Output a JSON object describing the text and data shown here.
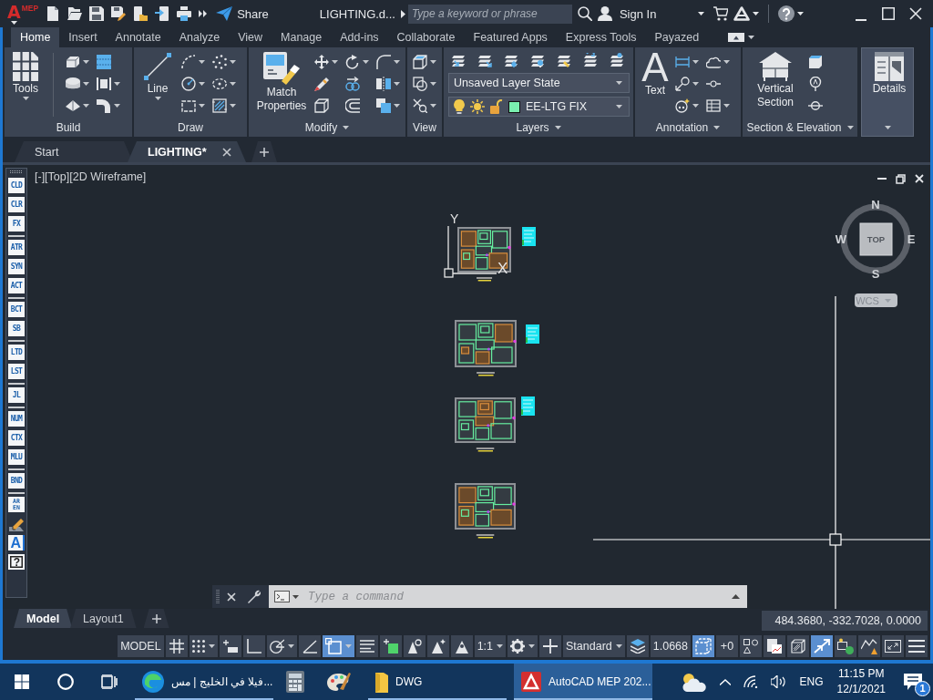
{
  "title_bar": {
    "app_letter": "A",
    "app_badge": "MEP",
    "share": "Share",
    "document": "LIGHTING.d...",
    "search": {
      "placeholder": "Type a keyword or phrase"
    },
    "sign_in": "Sign In"
  },
  "ribbon": {
    "tabs": [
      {
        "label": "Home",
        "selected": true
      },
      {
        "label": "Insert",
        "selected": false
      },
      {
        "label": "Annotate",
        "selected": false
      },
      {
        "label": "Analyze",
        "selected": false
      },
      {
        "label": "View",
        "selected": false
      },
      {
        "label": "Manage",
        "selected": false
      },
      {
        "label": "Add-ins",
        "selected": false
      },
      {
        "label": "Collaborate",
        "selected": false
      },
      {
        "label": "Featured Apps",
        "selected": false
      },
      {
        "label": "Express Tools",
        "selected": false
      },
      {
        "label": "Payazed",
        "selected": false
      }
    ],
    "panels": [
      {
        "kind": "build",
        "title": "Build",
        "menu": false,
        "large": {
          "label": "Tools",
          "dropdown": true
        }
      },
      {
        "kind": "draw",
        "title": "Draw",
        "menu": false,
        "large": {
          "label": "Line",
          "dropdown": true
        }
      },
      {
        "kind": "modify",
        "title": "Modify",
        "menu": true,
        "large": {
          "label": "Match Properties",
          "dropdown": false
        }
      },
      {
        "kind": "view",
        "title": "View",
        "menu": false
      },
      {
        "kind": "layers",
        "title": "Layers",
        "menu": true,
        "layer_state": "Unsaved Layer State",
        "layer": {
          "name": "EE-LTG FIX",
          "on": true,
          "frozen": false,
          "locked": false
        }
      },
      {
        "kind": "annotation",
        "title": "Annotation",
        "menu": true,
        "large": {
          "label": "Text",
          "glyph": "A",
          "dropdown": false
        }
      },
      {
        "kind": "section",
        "title": "Section & Elevation",
        "menu": true,
        "large": {
          "label": "Vertical Section",
          "dropdown": false
        }
      },
      {
        "kind": "details",
        "menu": true,
        "large": {
          "label": "Details",
          "dropdown": false
        }
      }
    ]
  },
  "document_tabs": [
    {
      "label": "Start",
      "selected": false
    },
    {
      "label": "LIGHTING*",
      "selected": true
    }
  ],
  "viewport": {
    "controls": [
      "[-]",
      "[Top]",
      "[2D Wireframe]"
    ],
    "ucs": {
      "x": "X",
      "y": "Y"
    },
    "view_cube": {
      "face": "TOP",
      "north": "N",
      "west": "W",
      "east": "E",
      "south": "S",
      "coordinate_system": "WCS"
    }
  },
  "tool_palette": {
    "groups": [
      [
        {
          "kind": "label",
          "label": "CLD"
        },
        {
          "kind": "label",
          "label": "CLR"
        },
        {
          "kind": "label",
          "label": "FX"
        }
      ],
      [
        {
          "kind": "label",
          "label": "ATR"
        },
        {
          "kind": "label",
          "label": "SYN"
        },
        {
          "kind": "label",
          "label": "ACT"
        }
      ],
      [
        {
          "kind": "label",
          "label": "BCT"
        },
        {
          "kind": "label",
          "label": "SB"
        }
      ],
      [
        {
          "kind": "label",
          "label": "LTD"
        },
        {
          "kind": "label",
          "label": "LST"
        }
      ],
      [
        {
          "kind": "label",
          "label": "JL"
        }
      ],
      [
        {
          "kind": "label",
          "label": "NUM"
        },
        {
          "kind": "label",
          "label": "CTX"
        },
        {
          "kind": "label",
          "label": "MLU"
        }
      ],
      [
        {
          "kind": "label",
          "label": "BND"
        }
      ],
      [
        {
          "kind": "stacked",
          "label": "AR EN"
        },
        {
          "kind": "edit"
        },
        {
          "kind": "letter",
          "label": "A"
        },
        {
          "kind": "framed",
          "label": "?"
        }
      ]
    ]
  },
  "command_line": {
    "placeholder": "Type a command"
  },
  "layout_tabs": [
    {
      "label": "Model",
      "selected": true
    },
    {
      "label": "Layout1",
      "selected": false
    }
  ],
  "coordinates": "484.3680, -332.7028, 0.0000",
  "status_bar": {
    "items": [
      {
        "kind": "text",
        "label": "MODEL",
        "on": false,
        "menu": false
      },
      {
        "kind": "icon",
        "on": false,
        "menu": false
      },
      {
        "kind": "icon",
        "on": false,
        "menu": true
      },
      {
        "kind": "icon",
        "on": false,
        "menu": false
      },
      {
        "kind": "icon",
        "on": false,
        "menu": false
      },
      {
        "kind": "icon",
        "on": false,
        "menu": true
      },
      {
        "kind": "icon",
        "on": false,
        "menu": false
      },
      {
        "kind": "icon",
        "on": true,
        "menu": true
      },
      {
        "kind": "icon",
        "on": false,
        "menu": false
      },
      {
        "kind": "icon",
        "on": false,
        "menu": false
      },
      {
        "kind": "icon",
        "on": false,
        "menu": false
      },
      {
        "kind": "icon",
        "on": false,
        "menu": false
      },
      {
        "kind": "icon",
        "on": false,
        "menu": false
      },
      {
        "kind": "text",
        "label": "1:1",
        "on": false,
        "menu": true
      },
      {
        "kind": "icon",
        "on": false,
        "menu": true
      },
      {
        "kind": "icon",
        "on": false,
        "menu": false
      },
      {
        "kind": "text",
        "label": "Standard",
        "on": false,
        "menu": true
      },
      {
        "kind": "icon",
        "on": false,
        "menu": false
      },
      {
        "kind": "text",
        "label": "1.0668",
        "on": false,
        "menu": false
      },
      {
        "kind": "icon",
        "on": true,
        "menu": false
      },
      {
        "kind": "text",
        "label": "+0",
        "on": false,
        "menu": false
      },
      {
        "kind": "icon",
        "on": false,
        "menu": false
      },
      {
        "kind": "icon",
        "on": false,
        "menu": false
      },
      {
        "kind": "icon",
        "on": false,
        "menu": false
      },
      {
        "kind": "icon",
        "on": true,
        "menu": false
      },
      {
        "kind": "icon",
        "on": false,
        "menu": false
      },
      {
        "kind": "icon",
        "on": false,
        "menu": false
      },
      {
        "kind": "icon",
        "on": false,
        "menu": false
      },
      {
        "kind": "icon",
        "on": false,
        "menu": false
      }
    ]
  },
  "taskbar": {
    "apps": [
      {
        "kind": "browser",
        "label": "فيلا في الخليج | مس...",
        "running": true,
        "selected": false
      },
      {
        "kind": "calculator",
        "running": false,
        "selected": false
      },
      {
        "kind": "paint",
        "running": false,
        "selected": false
      },
      {
        "kind": "folder",
        "label": "DWG",
        "running": true,
        "selected": false
      },
      {
        "kind": "cad",
        "label": "AutoCAD MEP 202...",
        "running": true,
        "selected": true
      }
    ],
    "language": "ENG",
    "time": "11:15 PM",
    "date": "12/1/2021",
    "notifications": "1"
  }
}
